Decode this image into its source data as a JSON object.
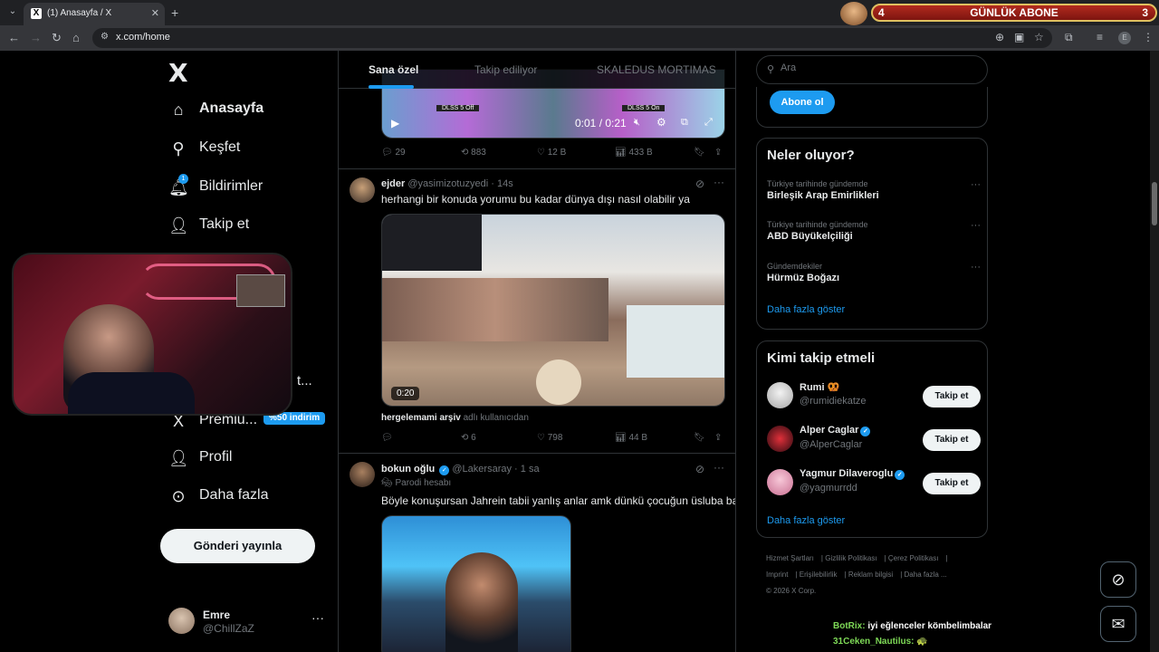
{
  "browser": {
    "tab_title": "(1) Anasayfa / X",
    "tab_favicon": "X",
    "url": "x.com/home",
    "overlay": {
      "left_num": "4",
      "title": "GÜNLÜK ABONE",
      "right_num": "3"
    }
  },
  "sidebar": {
    "logo": "X",
    "items": [
      {
        "label": "Anasayfa",
        "icon": "home-icon"
      },
      {
        "label": "Keşfet",
        "icon": "search-icon"
      },
      {
        "label": "Bildirimler",
        "icon": "bell-icon",
        "badge": "1"
      },
      {
        "label": "Takip et",
        "icon": "person-add-icon"
      },
      {
        "label": "Premiu...",
        "icon": "x-premium-icon",
        "badge": "%50 indirim"
      },
      {
        "label": "Profil",
        "icon": "person-icon"
      },
      {
        "label": "Daha fazla",
        "icon": "more-circle-icon"
      }
    ],
    "post_button": "Gönderi yayınla",
    "user": {
      "name": "Emre",
      "handle": "@ChillZaZ"
    },
    "partial_label": "t..."
  },
  "feed": {
    "tabs": [
      "Sana özel",
      "Takip ediliyor",
      "SKALEDUS MORTIMAS"
    ],
    "video1": {
      "time": "0:01 / 0:21",
      "label_left": "DLSS 5 Off",
      "label_right": "DLSS 5 On"
    },
    "post0_actions": {
      "replies": "29",
      "reposts": "883",
      "likes": "12 B",
      "views": "433 B"
    },
    "post1": {
      "name": "ejder",
      "handle": "@yasimizotuzyedi",
      "time": "14s",
      "text": "herhangi bir konuda yorumu bu kadar dünya dışı nasıl olabilir ya",
      "video_time": "0:20",
      "attribution_name": "hergelemami arşiv",
      "attribution_suffix": "adlı kullanıcıdan",
      "actions": {
        "replies": "",
        "reposts": "6",
        "likes": "798",
        "views": "44 B"
      }
    },
    "post2": {
      "name": "bokun oğlu",
      "handle": "@Lakersaray",
      "time": "1 sa",
      "parody": "Parodi hesabı",
      "text": "Böyle konuşursan Jahrein tabii yanlış anlar amk dünkü çocuğun üsluba bak"
    }
  },
  "right": {
    "search_placeholder": "Ara",
    "subscribe_button": "Abone ol",
    "trends_title": "Neler oluyor?",
    "trends": [
      {
        "context": "Türkiye tarihinde gündemde",
        "name": "Birleşik Arap Emirlikleri"
      },
      {
        "context": "Türkiye tarihinde gündemde",
        "name": "ABD Büyükelçiliği"
      },
      {
        "context": "Gündemdekiler",
        "name": "Hürmüz Boğazı"
      }
    ],
    "show_more": "Daha fazla göster",
    "who_title": "Kimi takip etmeli",
    "who": [
      {
        "name": "Rumi 🥨",
        "handle": "@rumidiekatze",
        "verified": false,
        "button": "Takip et"
      },
      {
        "name": "Alper Caglar",
        "handle": "@AlperCaglar",
        "verified": true,
        "button": "Takip et"
      },
      {
        "name": "Yagmur Dilaveroglu",
        "handle": "@yagmurrdd",
        "verified": true,
        "button": "Takip et"
      }
    ],
    "footer": [
      "Hizmet Şartları",
      "Gizlilik Politikası",
      "Çerez Politikası",
      "Imprint",
      "Erişilebilirlik",
      "Reklam bilgisi",
      "Daha fazla ...",
      "© 2026 X Corp."
    ],
    "chat": [
      {
        "user": "BotRix:",
        "msg": "iyi eğlenceler kömbelimbalar"
      },
      {
        "user": "31Ceken_Nautilus:",
        "msg": "🐢"
      }
    ]
  },
  "colors": {
    "accent": "#1d9bf0",
    "background": "#000000",
    "text": "#e7e9ea",
    "muted": "#71767b"
  }
}
